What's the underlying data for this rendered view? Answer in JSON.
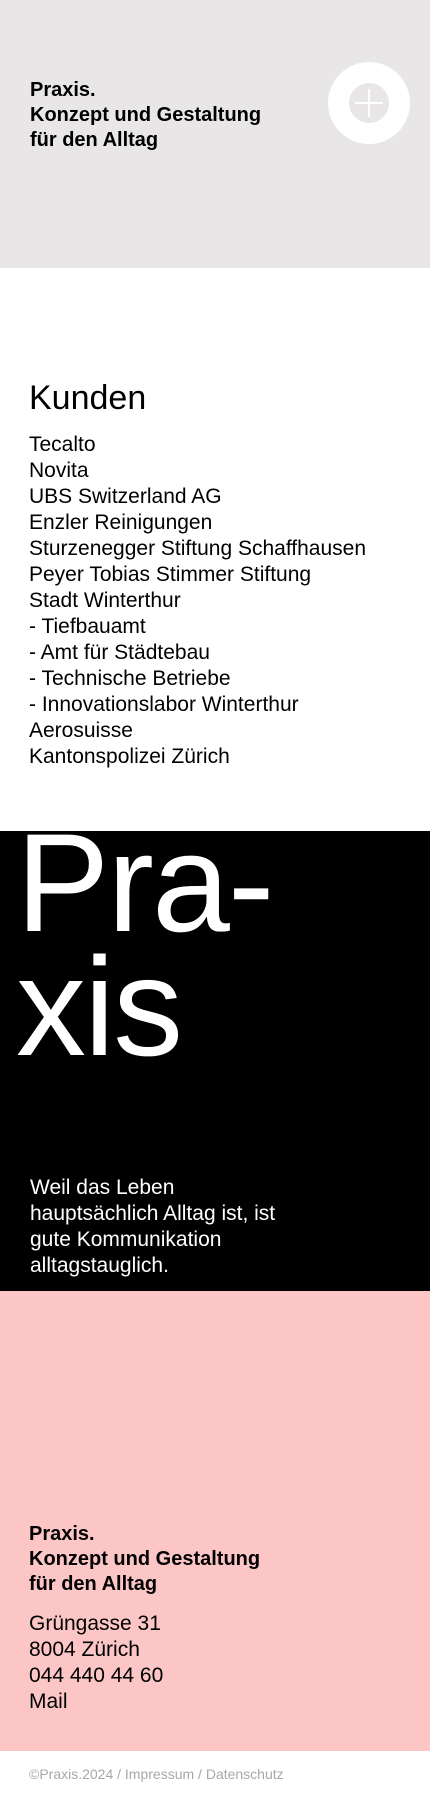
{
  "colors": {
    "header_bg": "#e8e6e7",
    "hero_bg": "#000000",
    "contact_bg": "#fdc6c6",
    "footer_text": "#a8a8a8"
  },
  "header": {
    "title_lines": [
      "Praxis.",
      "Konzept und Gestaltung",
      "für den Alltag"
    ],
    "menu_icon": "plus-icon"
  },
  "clients": {
    "title": "Kunden",
    "items": [
      "Tecalto",
      "Novita",
      "UBS Switzerland AG",
      "Enzler Reinigungen",
      "Sturzenegger Stiftung Schaffhausen",
      "Peyer Tobias Stimmer Stiftung",
      "Stadt Winterthur",
      "- Tiefbauamt",
      "- Amt für Städtebau",
      "- Technische Betriebe",
      "- Innovationslabor Winterthur",
      "Aerosuisse",
      "Kantonspolizei Zürich"
    ]
  },
  "hero": {
    "word_lines": [
      "Pra-",
      "xis"
    ],
    "tagline": "Weil das Leben hauptsächlich Alltag ist, ist gute Kommunikation alltagstauglich."
  },
  "contact": {
    "name_lines": [
      "Praxis.",
      "Konzept und Gestaltung",
      "für den Alltag"
    ],
    "street": "Grüngasse 31",
    "city": "8004 Zürich",
    "phone": "044 440 44 60",
    "mail_label": "Mail"
  },
  "footer": {
    "copyright": "©Praxis.2024",
    "separator": " / ",
    "impressum": "Impressum",
    "datenschutz": "Datenschutz"
  }
}
